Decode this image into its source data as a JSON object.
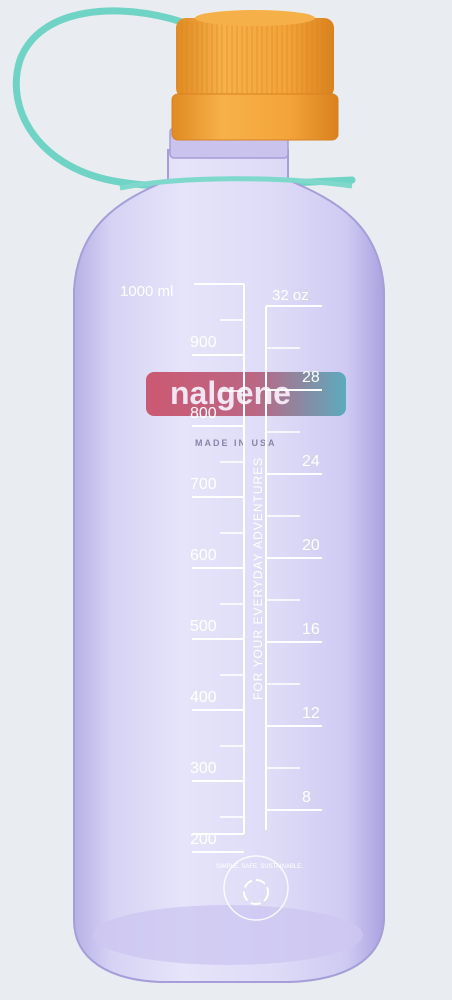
{
  "product": {
    "brand_text": "nalgene",
    "made_in": "MADE IN USA",
    "tagline": "FOR YOUR EVERYDAY ADVENTURES",
    "badge_text": "SIMPLE. SAFE. SUSTAINABLE."
  },
  "graduations": {
    "ml_top_label": "1000 ml",
    "ml_labels": [
      "900",
      "800",
      "700",
      "600",
      "500",
      "400",
      "300",
      "200"
    ],
    "oz_top_label": "32 oz",
    "oz_labels": [
      "28",
      "24",
      "20",
      "16",
      "12",
      "8"
    ]
  },
  "colors": {
    "background": "#e9ecf0",
    "bottle_tint": "#c9c3ee",
    "cap": "#f2a33a",
    "tether": "#6fd3c6",
    "logo_left": "#c94a63",
    "logo_right": "#4fa7b8"
  }
}
